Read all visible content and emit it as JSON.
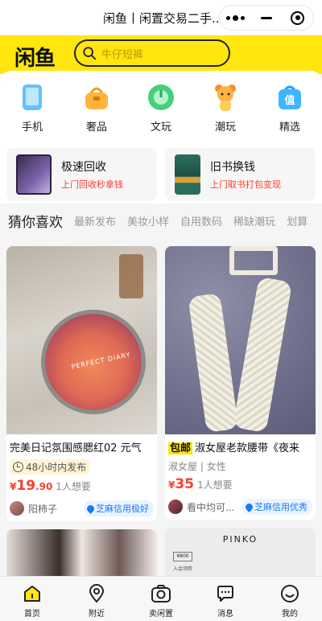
{
  "window": {
    "title": "闲鱼丨闲置交易二手..."
  },
  "header": {
    "logo": "闲鱼",
    "search_placeholder": "牛仔短裤"
  },
  "categories": [
    {
      "label": "手机",
      "icon": "phone-icon"
    },
    {
      "label": "奢品",
      "icon": "handbag-icon"
    },
    {
      "label": "文玩",
      "icon": "jade-icon"
    },
    {
      "label": "潮玩",
      "icon": "bear-toy-icon"
    },
    {
      "label": "精选",
      "icon": "value-bag-icon"
    }
  ],
  "promos": [
    {
      "title": "极速回收",
      "subtitle": "上门回收秒拿钱"
    },
    {
      "title": "旧书换钱",
      "subtitle": "上门取书打包变现"
    }
  ],
  "tabs": [
    "猜你喜欢",
    "最新发布",
    "美妆小样",
    "自用数码",
    "稀缺潮玩",
    "划算"
  ],
  "feed": {
    "left": {
      "title": "完美日记氛围感腮红02 元气",
      "meta": "48小时内发布",
      "price_currency": "¥",
      "price_int": "19",
      "price_dec": ".90",
      "want": "1人想要",
      "user": "阳柿子",
      "credit": "芝麻信用极好",
      "image_text": "PERFECT DIARY"
    },
    "right": {
      "badge": "包邮",
      "title": "淑女屋老款腰带《夜来",
      "tag1": "淑女屋",
      "tag2": "女性",
      "price_currency": "¥",
      "price_int": "35",
      "want": "1人想要",
      "user": "看中均可...",
      "credit": "芝麻信用优秀"
    },
    "right2_image_text": "PINKO",
    "right2_small_text": "入会领券"
  },
  "bottom_nav": [
    {
      "label": "首页",
      "icon": "home-icon"
    },
    {
      "label": "附近",
      "icon": "location-icon"
    },
    {
      "label": "卖闲置",
      "icon": "camera-icon"
    },
    {
      "label": "消息",
      "icon": "message-icon"
    },
    {
      "label": "我的",
      "icon": "profile-icon"
    }
  ],
  "colors": {
    "brand_yellow": "#ffe60f",
    "price_red": "#ff3b2f",
    "credit_blue": "#1677ff"
  }
}
